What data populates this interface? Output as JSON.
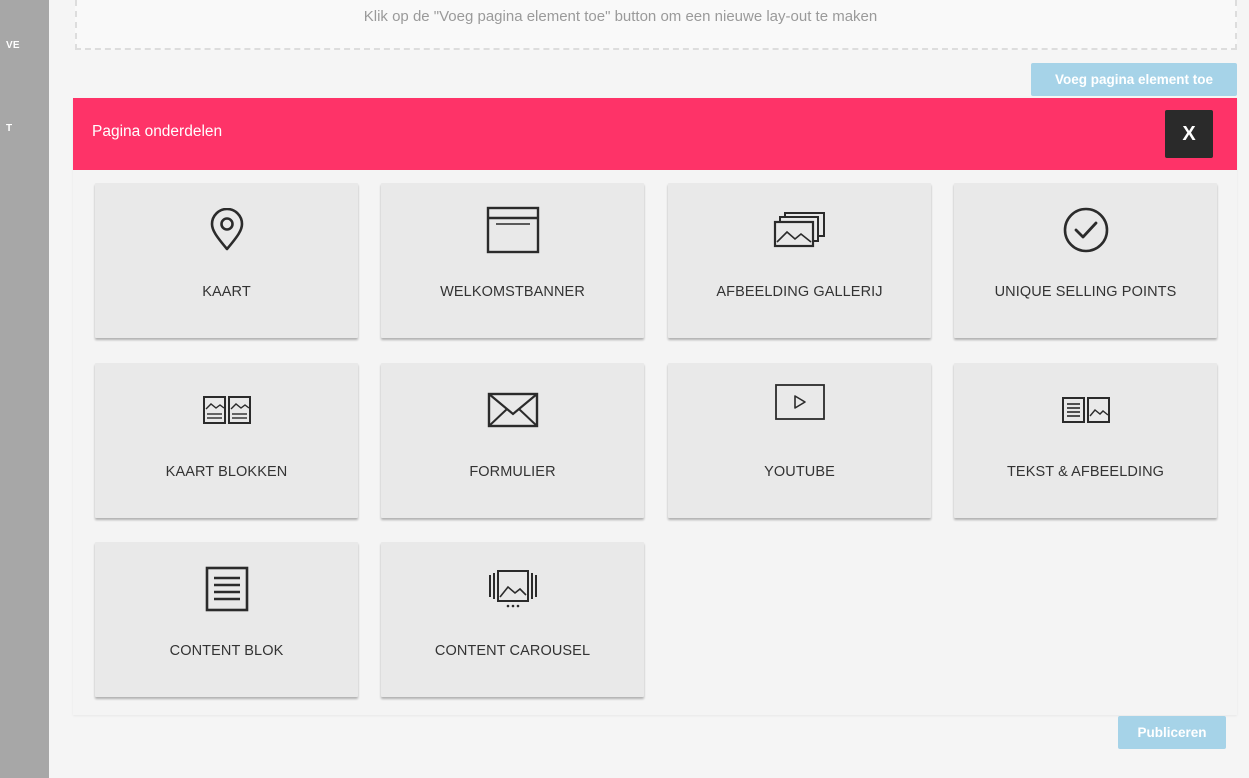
{
  "sidebar": {
    "labels": [
      "VE",
      "T"
    ]
  },
  "dropzone": {
    "text": "Klik op de \"Voeg pagina element toe\" button om een nieuwe lay-out te maken"
  },
  "buttons": {
    "add_element": "Voeg pagina element toe",
    "publish": "Publiceren"
  },
  "panel": {
    "title": "Pagina onderdelen",
    "close_label": "X",
    "header_color": "#fe3368"
  },
  "tiles": [
    {
      "label": "KAART",
      "icon": "map-pin-icon"
    },
    {
      "label": "WELKOMSTBANNER",
      "icon": "banner-icon"
    },
    {
      "label": "AFBEELDING GALLERIJ",
      "icon": "image-gallery-icon"
    },
    {
      "label": "UNIQUE SELLING POINTS",
      "icon": "check-circle-icon"
    },
    {
      "label": "KAART BLOKKEN",
      "icon": "card-blocks-icon"
    },
    {
      "label": "FORMULIER",
      "icon": "envelope-icon"
    },
    {
      "label": "YOUTUBE",
      "icon": "play-icon"
    },
    {
      "label": "TEKST & AFBEELDING",
      "icon": "text-image-icon"
    },
    {
      "label": "CONTENT BLOK",
      "icon": "content-block-icon"
    },
    {
      "label": "CONTENT CAROUSEL",
      "icon": "carousel-icon"
    }
  ]
}
